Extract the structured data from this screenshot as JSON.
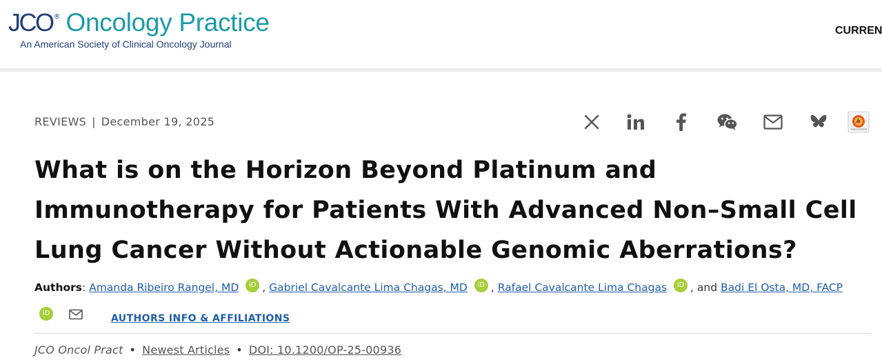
{
  "header": {
    "logo_prefix": "JCO",
    "logo_registered": "®",
    "logo_name": "Oncology Practice",
    "logo_tagline": "An American Society of Clinical Oncology Journal",
    "nav_current": "CURREN"
  },
  "article": {
    "section": "REVIEWS",
    "separator": "|",
    "date": "December 19, 2025",
    "title": "What is on the Horizon Beyond Platinum and Immunotherapy for Patients With Advanced Non–Small Cell Lung Cancer Without Actionable Genomic Aberrations?",
    "authors_label": "Authors",
    "authors_colon": ":",
    "authors": [
      {
        "name": "Amanda Ribeiro Rangel, MD"
      },
      {
        "name": "Gabriel Cavalcante Lima Chagas, MD"
      },
      {
        "name": "Rafael Cavalcante Lima Chagas"
      },
      {
        "name": "Badi El Osta, MD, FACP"
      }
    ],
    "comma": ",",
    "and_text": ", and",
    "orcid_label": "iD",
    "affiliations_link": "AUTHORS INFO & AFFILIATIONS"
  },
  "share": {
    "icons": [
      "x-icon",
      "linkedin-icon",
      "facebook-icon",
      "wechat-icon",
      "email-icon",
      "bluesky-icon",
      "mendeley-icon"
    ],
    "icon_color": "#555555"
  },
  "citation": {
    "journal": "JCO Oncol Pract",
    "bullet": "•",
    "section_link": "Newest Articles",
    "doi": "DOI: 10.1200/OP-25-00936"
  },
  "colors": {
    "brand_navy": "#1f3f77",
    "brand_teal": "#1b9aa6",
    "link_blue": "#1f5ea8",
    "orcid_green": "#a6ce39"
  }
}
